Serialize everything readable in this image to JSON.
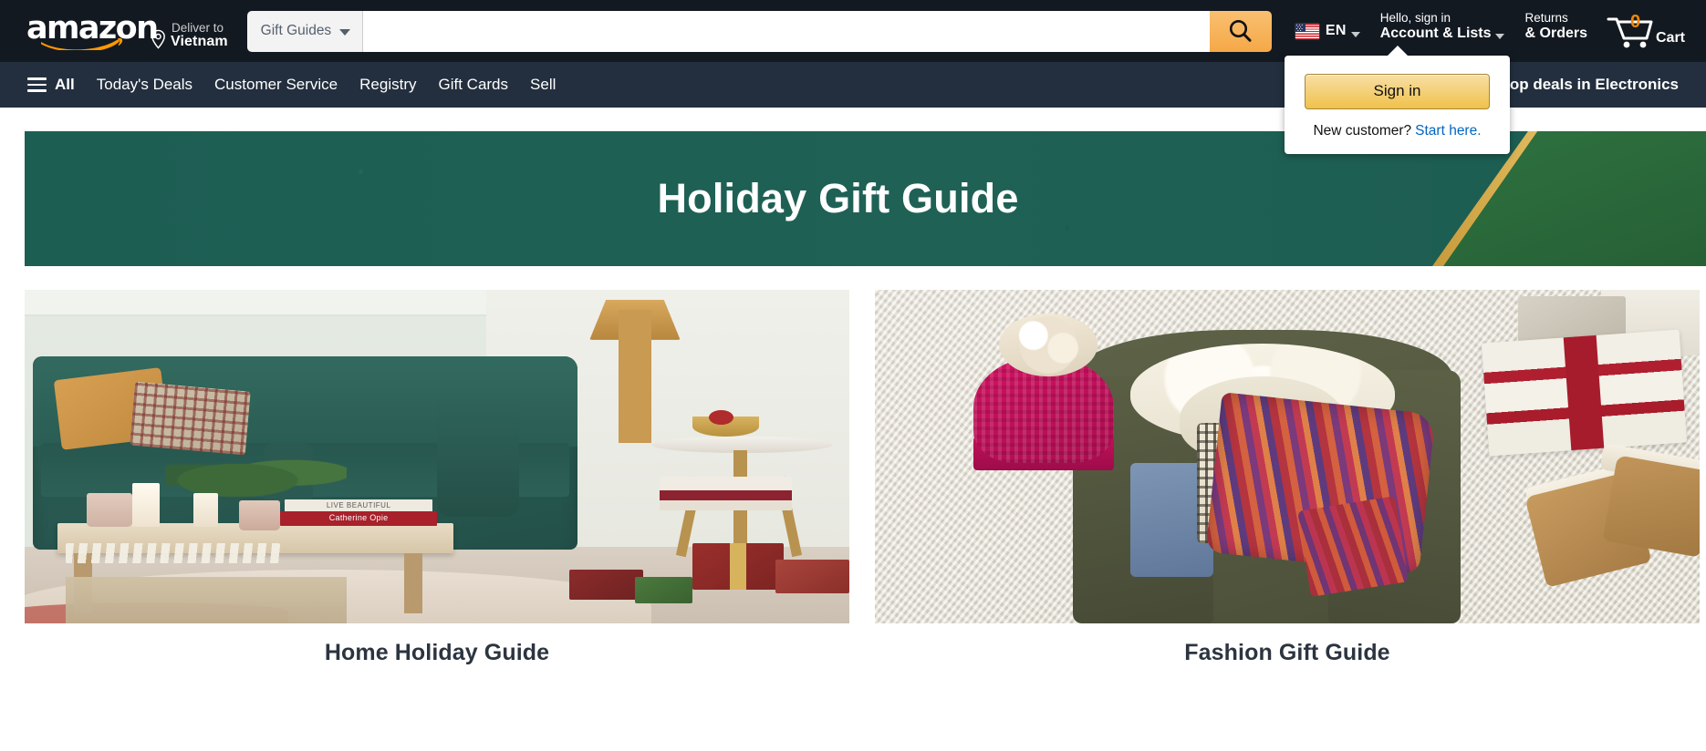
{
  "header": {
    "logo_text": "amazon",
    "deliver": {
      "line1": "Deliver to",
      "line2": "Vietnam",
      "icon": "location-pin-icon"
    },
    "search": {
      "category_label": "Gift Guides",
      "category_caret": "chevron-down-icon",
      "value": "",
      "placeholder": "",
      "button_icon": "search-icon",
      "button_color": "#febd69"
    },
    "language": {
      "flag": "us-flag-icon",
      "code": "EN",
      "caret": "chevron-down-icon"
    },
    "account": {
      "line1": "Hello, sign in",
      "line2": "Account & Lists",
      "caret": "chevron-down-icon"
    },
    "returns": {
      "line1": "Returns",
      "line2": "& Orders"
    },
    "cart": {
      "count": "0",
      "label": "Cart",
      "icon": "shopping-cart-icon",
      "count_color": "#f08804"
    },
    "background_color": "#131921"
  },
  "nav": {
    "background_color": "#232f3e",
    "all_label": "All",
    "all_icon": "hamburger-menu-icon",
    "items": [
      {
        "label": "Today's Deals"
      },
      {
        "label": "Customer Service"
      },
      {
        "label": "Registry"
      },
      {
        "label": "Gift Cards"
      },
      {
        "label": "Sell"
      }
    ],
    "right_promo": "Shop deals in Electronics"
  },
  "signin_flyout": {
    "visible": true,
    "button_label": "Sign in",
    "new_customer_text": "New customer?",
    "start_here_link": "Start here.",
    "link_color": "#0066c0",
    "button_color": "#f0c14b"
  },
  "banner": {
    "title": "Holiday Gift Guide",
    "background_color": "#1d5e53",
    "accent_green": "#2b6b3c",
    "accent_gold": "#d4a843"
  },
  "cards": [
    {
      "title": "Home Holiday Guide",
      "image_alt": "living-room-holiday-scene",
      "book_title": "LIVE BEAUTIFUL",
      "book_author": "Catherine Opie"
    },
    {
      "title": "Fashion Gift Guide",
      "image_alt": "winter-fashion-flatlay"
    }
  ],
  "title_color": "#2c3440"
}
